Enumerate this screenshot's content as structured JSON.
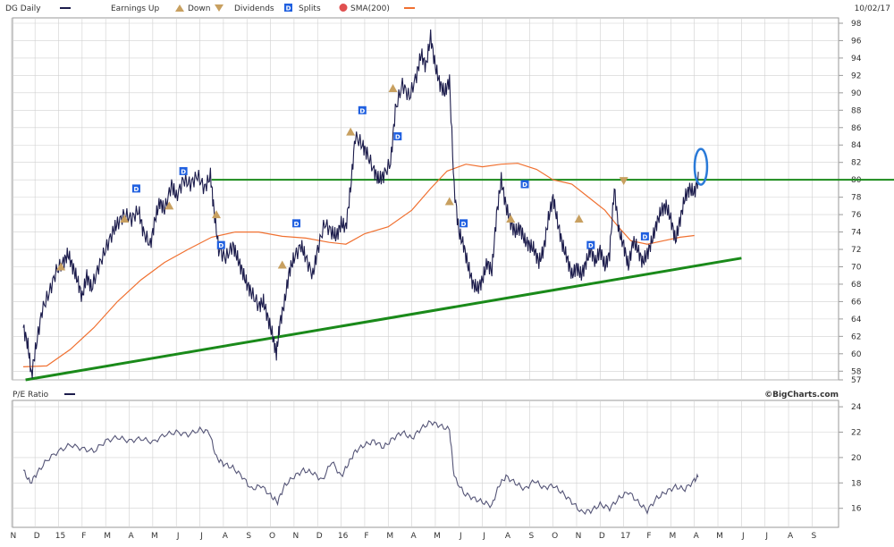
{
  "header": {
    "symbol_label": "DG Daily",
    "earnings_up_label": "Earnings Up",
    "down_label": "Down",
    "dividends_label": "Dividends",
    "dividend_marker": "D",
    "splits_label": "Splits",
    "sma_label": "SMA(200)",
    "date": "10/02/17"
  },
  "pe_header": {
    "label": "P/E Ratio",
    "credit": "©BigCharts.com"
  },
  "colors": {
    "price": "#1c1c4c",
    "sma": "#f07030",
    "trendline": "#1a8a1a",
    "dividend": "#2060e0",
    "earnings": "#c8a060",
    "highlight": "#2a7ad8",
    "grid": "#d0d0d0"
  },
  "chart_data": [
    {
      "type": "line",
      "title": "DG Daily",
      "y_ticks": [
        57,
        58,
        60,
        62,
        64,
        66,
        68,
        70,
        72,
        74,
        76,
        78,
        80,
        82,
        84,
        86,
        88,
        90,
        92,
        94,
        96,
        98
      ],
      "ylim": [
        57,
        98
      ],
      "x_labels": [
        "N",
        "D",
        "15",
        "F",
        "M",
        "A",
        "M",
        "J",
        "J",
        "A",
        "S",
        "O",
        "N",
        "D",
        "16",
        "F",
        "M",
        "A",
        "M",
        "J",
        "J",
        "A",
        "S",
        "O",
        "N",
        "D",
        "17",
        "F",
        "M",
        "A",
        "M",
        "J",
        "J",
        "A",
        "S"
      ],
      "grid": true,
      "series": [
        {
          "name": "price",
          "points": [
            [
              0,
              63
            ],
            [
              0.2,
              61
            ],
            [
              0.35,
              57.5
            ],
            [
              0.55,
              61
            ],
            [
              0.8,
              65
            ],
            [
              1.1,
              67
            ],
            [
              1.4,
              69.5
            ],
            [
              1.7,
              70.5
            ],
            [
              1.9,
              71.5
            ],
            [
              2.1,
              70
            ],
            [
              2.3,
              68.5
            ],
            [
              2.5,
              66.5
            ],
            [
              2.7,
              69
            ],
            [
              2.9,
              67.5
            ],
            [
              3.2,
              70
            ],
            [
              3.5,
              72
            ],
            [
              3.8,
              74
            ],
            [
              4.0,
              75
            ],
            [
              4.3,
              76
            ],
            [
              4.6,
              75.5
            ],
            [
              4.9,
              76.5
            ],
            [
              5.1,
              74
            ],
            [
              5.4,
              72.5
            ],
            [
              5.6,
              75.5
            ],
            [
              5.8,
              77.5
            ],
            [
              6.0,
              76.5
            ],
            [
              6.3,
              79.5
            ],
            [
              6.5,
              78
            ],
            [
              6.8,
              80
            ],
            [
              7.1,
              79.5
            ],
            [
              7.4,
              80.5
            ],
            [
              7.7,
              79
            ],
            [
              7.95,
              80.5
            ],
            [
              8.1,
              76.5
            ],
            [
              8.3,
              72
            ],
            [
              8.6,
              71
            ],
            [
              8.9,
              72.5
            ],
            [
              9.1,
              71
            ],
            [
              9.3,
              69.5
            ],
            [
              9.5,
              68
            ],
            [
              9.7,
              67
            ],
            [
              10.0,
              65.5
            ],
            [
              10.2,
              66
            ],
            [
              10.4,
              64
            ],
            [
              10.6,
              62
            ],
            [
              10.75,
              60
            ],
            [
              10.9,
              63.5
            ],
            [
              11.1,
              66
            ],
            [
              11.3,
              69.5
            ],
            [
              11.5,
              71
            ],
            [
              11.8,
              72.5
            ],
            [
              12.0,
              71
            ],
            [
              12.3,
              69
            ],
            [
              12.5,
              72
            ],
            [
              12.8,
              75
            ],
            [
              13.1,
              74
            ],
            [
              13.3,
              73.5
            ],
            [
              13.5,
              75
            ],
            [
              13.7,
              74.5
            ],
            [
              13.9,
              79
            ],
            [
              14.1,
              85
            ],
            [
              14.4,
              84
            ],
            [
              14.6,
              83
            ],
            [
              14.9,
              81
            ],
            [
              15.1,
              80
            ],
            [
              15.3,
              80.5
            ],
            [
              15.6,
              82
            ],
            [
              15.8,
              88
            ],
            [
              16.1,
              91
            ],
            [
              16.4,
              89.5
            ],
            [
              16.7,
              92
            ],
            [
              16.9,
              94.5
            ],
            [
              17.1,
              93
            ],
            [
              17.3,
              96.5
            ],
            [
              17.5,
              93
            ],
            [
              17.7,
              91
            ],
            [
              17.9,
              90
            ],
            [
              18.1,
              91.5
            ],
            [
              18.3,
              79
            ],
            [
              18.5,
              74
            ],
            [
              18.7,
              72.5
            ],
            [
              18.9,
              70
            ],
            [
              19.1,
              68
            ],
            [
              19.3,
              67.5
            ],
            [
              19.5,
              68.5
            ],
            [
              19.7,
              70.5
            ],
            [
              19.9,
              69.5
            ],
            [
              20.1,
              76
            ],
            [
              20.3,
              80
            ],
            [
              20.5,
              77
            ],
            [
              20.7,
              75
            ],
            [
              20.9,
              74
            ],
            [
              21.1,
              74.5
            ],
            [
              21.3,
              73
            ],
            [
              21.5,
              72.5
            ],
            [
              21.7,
              72
            ],
            [
              21.9,
              70.5
            ],
            [
              22.1,
              72
            ],
            [
              22.3,
              75.5
            ],
            [
              22.5,
              78
            ],
            [
              22.7,
              75
            ],
            [
              22.9,
              72.5
            ],
            [
              23.1,
              71
            ],
            [
              23.3,
              69
            ],
            [
              23.5,
              70
            ],
            [
              23.7,
              69
            ],
            [
              23.9,
              70.5
            ],
            [
              24.1,
              72
            ],
            [
              24.3,
              70.5
            ],
            [
              24.5,
              72
            ],
            [
              24.7,
              70
            ],
            [
              24.9,
              71.5
            ],
            [
              25.1,
              79
            ],
            [
              25.3,
              74
            ],
            [
              25.5,
              72.5
            ],
            [
              25.7,
              70
            ],
            [
              25.9,
              73
            ],
            [
              26.1,
              72
            ],
            [
              26.3,
              70.5
            ],
            [
              26.5,
              71.5
            ],
            [
              26.7,
              73
            ],
            [
              26.9,
              75
            ],
            [
              27.1,
              76.5
            ],
            [
              27.3,
              77
            ],
            [
              27.5,
              75.5
            ],
            [
              27.7,
              73
            ],
            [
              27.9,
              75.5
            ],
            [
              28.1,
              78
            ],
            [
              28.3,
              79
            ],
            [
              28.5,
              78.5
            ],
            [
              28.7,
              80.5
            ]
          ]
        },
        {
          "name": "SMA(200)",
          "points": [
            [
              0,
              58.5
            ],
            [
              1,
              58.6
            ],
            [
              2,
              60.5
            ],
            [
              3,
              63
            ],
            [
              4,
              66
            ],
            [
              5,
              68.5
            ],
            [
              6,
              70.5
            ],
            [
              7,
              72
            ],
            [
              8,
              73.4
            ],
            [
              9,
              74
            ],
            [
              10,
              74
            ],
            [
              11,
              73.5
            ],
            [
              12,
              73.3
            ],
            [
              13,
              72.8
            ],
            [
              13.7,
              72.6
            ],
            [
              14.5,
              73.8
            ],
            [
              15.5,
              74.6
            ],
            [
              16.5,
              76.5
            ],
            [
              17.3,
              79
            ],
            [
              18,
              81
            ],
            [
              18.8,
              81.8
            ],
            [
              19.5,
              81.5
            ],
            [
              20.3,
              81.8
            ],
            [
              21,
              81.9
            ],
            [
              21.8,
              81.2
            ],
            [
              22.5,
              80
            ],
            [
              23.3,
              79.5
            ],
            [
              24,
              78
            ],
            [
              24.7,
              76.5
            ],
            [
              25.3,
              74.5
            ],
            [
              25.8,
              73
            ],
            [
              26.5,
              72.6
            ],
            [
              27.2,
              73
            ],
            [
              27.9,
              73.4
            ],
            [
              28.5,
              73.6
            ]
          ]
        },
        {
          "name": "trendline",
          "points": [
            [
              0.1,
              57
            ],
            [
              30.5,
              71
            ]
          ]
        },
        {
          "name": "resistance",
          "points": [
            [
              8,
              80
            ],
            [
              30.5,
              80
            ]
          ]
        }
      ],
      "dividends": [
        [
          4.8,
          79
        ],
        [
          6.8,
          81
        ],
        [
          11.6,
          75
        ],
        [
          8.4,
          72.5
        ],
        [
          14.4,
          88
        ],
        [
          15.9,
          85
        ],
        [
          18.7,
          75
        ],
        [
          21.3,
          79.5
        ],
        [
          24.1,
          72.5
        ],
        [
          26.4,
          73.5
        ]
      ],
      "earnings_up": [
        [
          1.6,
          70
        ],
        [
          4.3,
          75.5
        ],
        [
          6.2,
          77
        ],
        [
          8.2,
          76
        ],
        [
          11.0,
          70.2
        ],
        [
          13.9,
          85.5
        ],
        [
          15.7,
          90.5
        ],
        [
          18.1,
          77.5
        ],
        [
          20.7,
          75.5
        ],
        [
          23.6,
          75.5
        ]
      ],
      "earnings_down": [
        [
          25.5,
          79.8
        ]
      ]
    },
    {
      "type": "line",
      "title": "P/E Ratio",
      "y_ticks": [
        16,
        18,
        20,
        22,
        24
      ],
      "ylim": [
        14.5,
        24.5
      ],
      "x_labels": [
        "N",
        "D",
        "15",
        "F",
        "M",
        "A",
        "M",
        "J",
        "J",
        "A",
        "S",
        "O",
        "N",
        "D",
        "16",
        "F",
        "M",
        "A",
        "M",
        "J",
        "J",
        "A",
        "S",
        "O",
        "N",
        "D",
        "17",
        "F",
        "M",
        "A",
        "M",
        "J",
        "J",
        "A",
        "S"
      ],
      "grid": true,
      "series": [
        {
          "name": "P/E Ratio",
          "points": [
            [
              0,
              19
            ],
            [
              0.3,
              18
            ],
            [
              0.6,
              18.8
            ],
            [
              1,
              19.8
            ],
            [
              1.5,
              20.5
            ],
            [
              2,
              21
            ],
            [
              2.5,
              20.7
            ],
            [
              3,
              20.5
            ],
            [
              3.5,
              21.3
            ],
            [
              4,
              21.6
            ],
            [
              4.5,
              21.3
            ],
            [
              5,
              21.5
            ],
            [
              5.5,
              21.2
            ],
            [
              6,
              21.8
            ],
            [
              6.5,
              22
            ],
            [
              7,
              21.8
            ],
            [
              7.5,
              22.2
            ],
            [
              7.9,
              22
            ],
            [
              8.2,
              20
            ],
            [
              8.5,
              19.5
            ],
            [
              8.9,
              19.2
            ],
            [
              9.3,
              18.5
            ],
            [
              9.7,
              17.5
            ],
            [
              10.1,
              17.8
            ],
            [
              10.5,
              17
            ],
            [
              10.8,
              16.5
            ],
            [
              11.1,
              17.8
            ],
            [
              11.5,
              18.5
            ],
            [
              11.9,
              19
            ],
            [
              12.3,
              18.8
            ],
            [
              12.7,
              18.2
            ],
            [
              13.1,
              19.7
            ],
            [
              13.5,
              18.5
            ],
            [
              13.8,
              19.5
            ],
            [
              14.1,
              20.5
            ],
            [
              14.5,
              21
            ],
            [
              14.9,
              21.3
            ],
            [
              15.3,
              20.8
            ],
            [
              15.7,
              21.5
            ],
            [
              16.1,
              22
            ],
            [
              16.5,
              21.5
            ],
            [
              16.9,
              22.3
            ],
            [
              17.3,
              22.8
            ],
            [
              17.7,
              22.5
            ],
            [
              18.1,
              22.2
            ],
            [
              18.3,
              18.5
            ],
            [
              18.7,
              17.2
            ],
            [
              19.1,
              16.8
            ],
            [
              19.5,
              16.5
            ],
            [
              19.9,
              16.2
            ],
            [
              20.2,
              17.8
            ],
            [
              20.5,
              18.5
            ],
            [
              20.9,
              18
            ],
            [
              21.3,
              17.5
            ],
            [
              21.7,
              18.2
            ],
            [
              22.1,
              17.6
            ],
            [
              22.5,
              17.8
            ],
            [
              22.9,
              17.2
            ],
            [
              23.3,
              16.5
            ],
            [
              23.7,
              15.7
            ],
            [
              24.1,
              15.8
            ],
            [
              24.5,
              16.3
            ],
            [
              24.9,
              16
            ],
            [
              25.3,
              16.8
            ],
            [
              25.7,
              17.3
            ],
            [
              26.1,
              16.5
            ],
            [
              26.5,
              15.8
            ],
            [
              26.9,
              16.8
            ],
            [
              27.3,
              17.3
            ],
            [
              27.7,
              17.7
            ],
            [
              28.1,
              17.5
            ],
            [
              28.5,
              18.2
            ],
            [
              28.7,
              18.6
            ]
          ]
        }
      ]
    }
  ]
}
